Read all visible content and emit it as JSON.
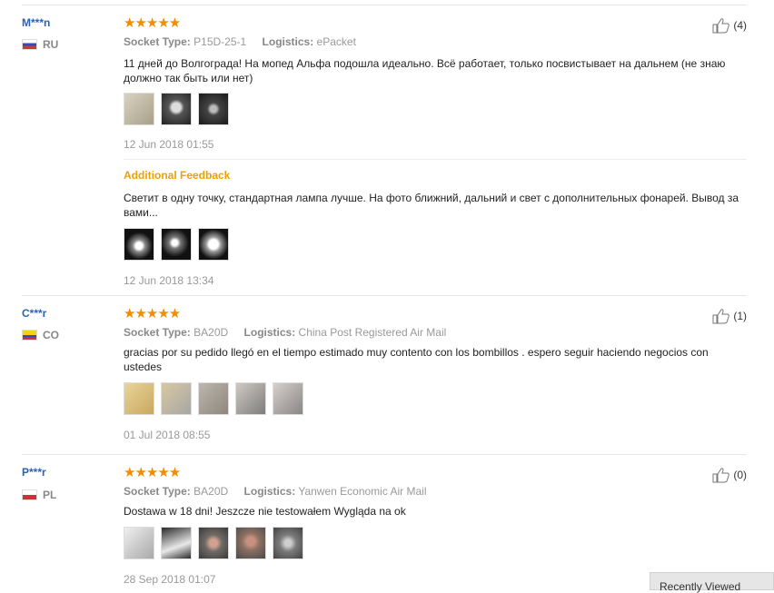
{
  "reviews": [
    {
      "user": "M***n",
      "country": "RU",
      "helpful_count": "(4)",
      "socket_label": "Socket Type:",
      "socket_value": "P15D-25-1",
      "logistics_label": "Logistics:",
      "logistics_value": "ePacket",
      "text": "11 дней до Волгограда! На мопед Альфа подошла идеально. Всё работает, только посвистывает на дальнем (не знаю должно так быть или нет)",
      "date": "12 Jun 2018 01:55",
      "additional_title": "Additional Feedback",
      "additional_text": "Светит в одну точку, стандартная лампа лучше. На фото ближний, дальний и свет с дополнительных фонарей. Вывод за вами...",
      "additional_date": "12 Jun 2018 13:34"
    },
    {
      "user": "C***r",
      "country": "CO",
      "helpful_count": "(1)",
      "socket_label": "Socket Type:",
      "socket_value": "BA20D",
      "logistics_label": "Logistics:",
      "logistics_value": "China Post Registered Air Mail",
      "text": "gracias por su pedido llegó en el tiempo estimado muy contento con los bombillos . espero seguir haciendo negocios con ustedes",
      "date": "01 Jul 2018 08:55"
    },
    {
      "user": "P***r",
      "country": "PL",
      "helpful_count": "(0)",
      "socket_label": "Socket Type:",
      "socket_value": "BA20D",
      "logistics_label": "Logistics:",
      "logistics_value": "Yanwen Economic Air Mail",
      "text": "Dostawa w 18 dni! Jeszcze nie testowałem Wygląda na ok",
      "date": "28 Sep 2018 01:07"
    }
  ],
  "stars_glyphs": "★★★★★",
  "recently_viewed": "Recently Viewed",
  "colors": {
    "star": "#f28c00",
    "username": "#2a63b3",
    "additional_feedback": "#f0a000"
  },
  "icons": [
    "thumb-up-icon",
    "flag-ru-icon",
    "flag-co-icon",
    "flag-pl-icon",
    "star-icon"
  ]
}
